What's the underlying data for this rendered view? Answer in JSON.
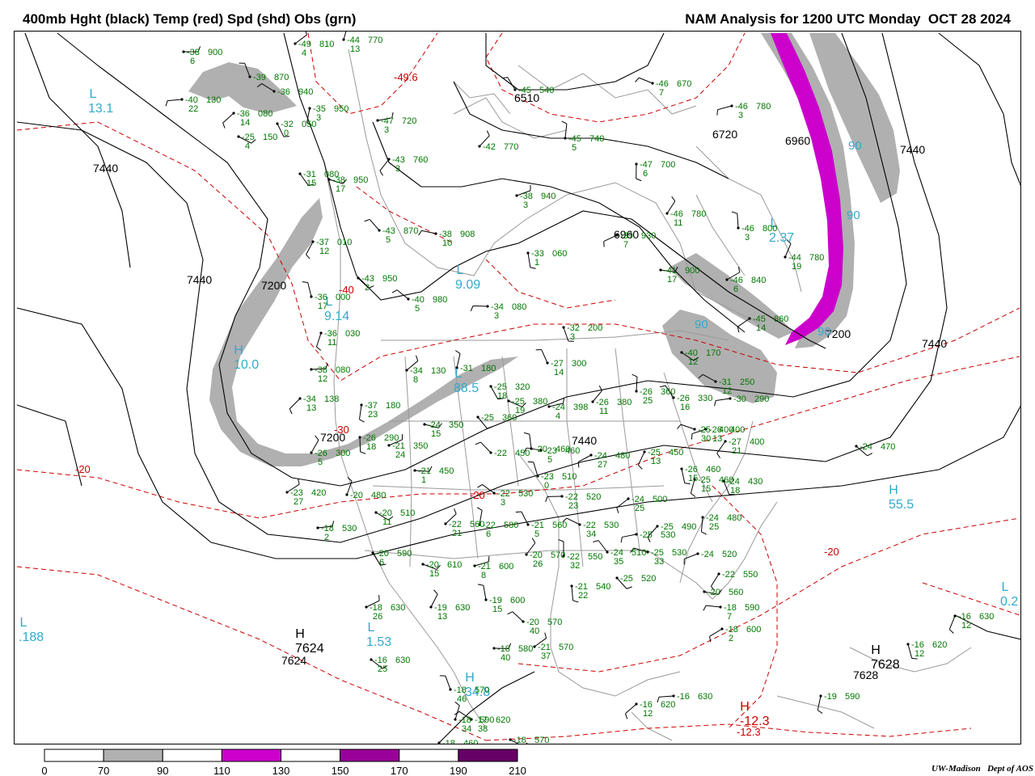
{
  "header": {
    "title_left": "400mb Hght (black) Temp (red) Spd (shd) Obs (grn)",
    "title_right": "NAM Analysis for 1200 UTC Monday  OCT 28 2024"
  },
  "colors": {
    "height_contour": "#000000",
    "temperature_contour": "#cc0000",
    "observation": "#007700",
    "extrema_label": "#33aacc",
    "geography": "#999999",
    "speed_70_90": "#b0b0b0",
    "speed_110_130": "#cc00cc",
    "speed_150_170": "#990099",
    "speed_190_210": "#660066"
  },
  "colorbar": {
    "ticks": [
      "0",
      "70",
      "90",
      "110",
      "130",
      "150",
      "170",
      "190",
      "210"
    ],
    "bins": [
      {
        "from": 0,
        "to": 70,
        "color": "#ffffff"
      },
      {
        "from": 70,
        "to": 90,
        "color": "#b0b0b0"
      },
      {
        "from": 90,
        "to": 110,
        "color": "#ffffff"
      },
      {
        "from": 110,
        "to": 130,
        "color": "#cc00cc"
      },
      {
        "from": 130,
        "to": 150,
        "color": "#ffffff"
      },
      {
        "from": 150,
        "to": 170,
        "color": "#990099"
      },
      {
        "from": 170,
        "to": 190,
        "color": "#ffffff"
      },
      {
        "from": 190,
        "to": 210,
        "color": "#660066"
      }
    ]
  },
  "height_labels": [
    "7440",
    "7200",
    "7440",
    "7200",
    "6960",
    "6720",
    "7440",
    "7440",
    "7200",
    "7440",
    "6510",
    "7624",
    "7628",
    "6960"
  ],
  "temperature_labels": [
    "-20",
    "-20",
    "-20",
    "-30",
    "-40",
    "-49.6",
    "-12.3"
  ],
  "extrema": [
    {
      "letter": "L",
      "value": "13.1"
    },
    {
      "letter": "H",
      "value": "10.0"
    },
    {
      "letter": "L",
      "value": "9.09"
    },
    {
      "letter": "L",
      "value": "9.14"
    },
    {
      "letter": "L",
      "value": "88.5"
    },
    {
      "letter": "H",
      "value": "55.5"
    },
    {
      "letter": "L",
      "value": "1.53"
    },
    {
      "letter": "L",
      "value": ".188"
    },
    {
      "letter": "H",
      "value": "34.8"
    },
    {
      "letter": "L",
      "value": "0.2"
    },
    {
      "letter": "L",
      "value": "2.37"
    },
    {
      "letter": "H",
      "value": "7624"
    },
    {
      "letter": "H",
      "value": "7628"
    },
    {
      "letter": "H",
      "value": "-12.3"
    }
  ],
  "speed_labels": [
    "90",
    "90",
    "90",
    "90"
  ],
  "observations": [
    {
      "t": "-38",
      "h": "900",
      "d": "6"
    },
    {
      "t": "-49",
      "h": "810",
      "d": "4"
    },
    {
      "t": "-44",
      "h": "770",
      "d": "13"
    },
    {
      "t": "-39",
      "h": "870",
      "d": ""
    },
    {
      "t": "-36",
      "h": "940",
      "d": ""
    },
    {
      "t": "-40",
      "h": "130",
      "d": "22"
    },
    {
      "t": "-36",
      "h": "080",
      "d": "14"
    },
    {
      "t": "-35",
      "h": "950",
      "d": "3"
    },
    {
      "t": "-32",
      "h": "050",
      "d": "0"
    },
    {
      "t": "-25",
      "h": "150",
      "d": "4"
    },
    {
      "t": "-47",
      "h": "720",
      "d": "3"
    },
    {
      "t": "-42",
      "h": "770",
      "d": ""
    },
    {
      "t": "-45",
      "h": "740",
      "d": "5"
    },
    {
      "t": "-45",
      "h": "540",
      "d": ""
    },
    {
      "t": "-46",
      "h": "670",
      "d": "7"
    },
    {
      "t": "-46",
      "h": "780",
      "d": "3"
    },
    {
      "t": "-43",
      "h": "760",
      "d": "3"
    },
    {
      "t": "-47",
      "h": "700",
      "d": "6"
    },
    {
      "t": "-31",
      "h": "080",
      "d": "15"
    },
    {
      "t": "-38",
      "h": "950",
      "d": "17"
    },
    {
      "t": "-38",
      "h": "940",
      "d": "3"
    },
    {
      "t": "-46",
      "h": "780",
      "d": "11"
    },
    {
      "t": "-46",
      "h": "800",
      "d": "3"
    },
    {
      "t": "-43",
      "h": "870",
      "d": "5"
    },
    {
      "t": "-38",
      "h": "908",
      "d": "10"
    },
    {
      "t": "-39",
      "h": "930",
      "d": "7"
    },
    {
      "t": "-37",
      "h": "010",
      "d": "12"
    },
    {
      "t": "-33",
      "h": "060",
      "d": "1"
    },
    {
      "t": "-43",
      "h": "950",
      "d": "2"
    },
    {
      "t": "-41",
      "h": "900",
      "d": "17"
    },
    {
      "t": "-46",
      "h": "840",
      "d": "6"
    },
    {
      "t": "-44",
      "h": "780",
      "d": "19"
    },
    {
      "t": "-36",
      "h": "000",
      "d": "17"
    },
    {
      "t": "-40",
      "h": "980",
      "d": "5"
    },
    {
      "t": "-34",
      "h": "080",
      "d": "3"
    },
    {
      "t": "-45",
      "h": "860",
      "d": "14"
    },
    {
      "t": "-36",
      "h": "030",
      "d": "11"
    },
    {
      "t": "-32",
      "h": "200",
      "d": "3"
    },
    {
      "t": "-40",
      "h": "170",
      "d": "12"
    },
    {
      "t": "-38",
      "h": "080",
      "d": "12"
    },
    {
      "t": "-34",
      "h": "130",
      "d": "8"
    },
    {
      "t": "-31",
      "h": "180",
      "d": ""
    },
    {
      "t": "-27",
      "h": "300",
      "d": "14"
    },
    {
      "t": "-31",
      "h": "250",
      "d": "12"
    },
    {
      "t": "-30",
      "h": "290",
      "d": ""
    },
    {
      "t": "-34",
      "h": "138",
      "d": "13"
    },
    {
      "t": "-37",
      "h": "180",
      "d": "23"
    },
    {
      "t": "-25",
      "h": "320",
      "d": "18"
    },
    {
      "t": "-25",
      "h": "380",
      "d": "19"
    },
    {
      "t": "-24",
      "h": "398",
      "d": "4"
    },
    {
      "t": "-26",
      "h": "380",
      "d": "11"
    },
    {
      "t": "-26",
      "h": "360",
      "d": "25"
    },
    {
      "t": "-26",
      "h": "330",
      "d": "16"
    },
    {
      "t": "-25",
      "h": "400",
      "d": "30"
    },
    {
      "t": "-26",
      "h": "400",
      "d": "13"
    },
    {
      "t": "-27",
      "h": "400",
      "d": "21"
    },
    {
      "t": "-26",
      "h": "290",
      "d": "18"
    },
    {
      "t": "-25",
      "h": "360",
      "d": ""
    },
    {
      "t": "-24",
      "h": "350",
      "d": "15"
    },
    {
      "t": "-21",
      "h": "350",
      "d": "24"
    },
    {
      "t": "-26",
      "h": "300",
      "d": "5"
    },
    {
      "t": "-20",
      "h": "460",
      "d": ""
    },
    {
      "t": "-22",
      "h": "450",
      "d": ""
    },
    {
      "t": "-23",
      "h": "460",
      "d": "5"
    },
    {
      "t": "-24",
      "h": "480",
      "d": "27"
    },
    {
      "t": "-25",
      "h": "450",
      "d": "13"
    },
    {
      "t": "-26",
      "h": "460",
      "d": "15"
    },
    {
      "t": "-24",
      "h": "470",
      "d": ""
    },
    {
      "t": "-21",
      "h": "450",
      "d": "1"
    },
    {
      "t": "-23",
      "h": "420",
      "d": "27"
    },
    {
      "t": "-20",
      "h": "480",
      "d": ""
    },
    {
      "t": "-23",
      "h": "510",
      "d": "0"
    },
    {
      "t": "-22",
      "h": "530",
      "d": "3"
    },
    {
      "t": "-22",
      "h": "520",
      "d": "23"
    },
    {
      "t": "-24",
      "h": "500",
      "d": "25"
    },
    {
      "t": "-25",
      "h": "460",
      "d": "15"
    },
    {
      "t": "-24",
      "h": "430",
      "d": "18"
    },
    {
      "t": "-20",
      "h": "510",
      "d": "11"
    },
    {
      "t": "-18",
      "h": "530",
      "d": "2"
    },
    {
      "t": "-22",
      "h": "560",
      "d": "21"
    },
    {
      "t": "-22",
      "h": "580",
      "d": "6"
    },
    {
      "t": "-21",
      "h": "560",
      "d": "5"
    },
    {
      "t": "-22",
      "h": "530",
      "d": "34"
    },
    {
      "t": "-25",
      "h": "530",
      "d": ""
    },
    {
      "t": "-25",
      "h": "490",
      "d": ""
    },
    {
      "t": "-24",
      "h": "480",
      "d": "25"
    },
    {
      "t": "-20",
      "h": "590",
      "d": "6"
    },
    {
      "t": "-20",
      "h": "610",
      "d": "15"
    },
    {
      "t": "-21",
      "h": "600",
      "d": "8"
    },
    {
      "t": "-20",
      "h": "570",
      "d": "26"
    },
    {
      "t": "-22",
      "h": "550",
      "d": "32"
    },
    {
      "t": "-24",
      "h": "510",
      "d": "35"
    },
    {
      "t": "-25",
      "h": "530",
      "d": "33"
    },
    {
      "t": "-24",
      "h": "520",
      "d": ""
    },
    {
      "t": "-22",
      "h": "550",
      "d": ""
    },
    {
      "t": "-21",
      "h": "540",
      "d": "22"
    },
    {
      "t": "-25",
      "h": "520",
      "d": ""
    },
    {
      "t": "-20",
      "h": "560",
      "d": ""
    },
    {
      "t": "-18",
      "h": "630",
      "d": "26"
    },
    {
      "t": "-19",
      "h": "630",
      "d": "13"
    },
    {
      "t": "-19",
      "h": "600",
      "d": "15"
    },
    {
      "t": "-20",
      "h": "570",
      "d": "40"
    },
    {
      "t": "-18",
      "h": "590",
      "d": "7"
    },
    {
      "t": "-18",
      "h": "600",
      "d": "2"
    },
    {
      "t": "-16",
      "h": "630",
      "d": "12"
    },
    {
      "t": "-16",
      "h": "620",
      "d": "12"
    },
    {
      "t": "-16",
      "h": "630",
      "d": "25"
    },
    {
      "t": "-18",
      "h": "580",
      "d": "40"
    },
    {
      "t": "-21",
      "h": "570",
      "d": "37"
    },
    {
      "t": "-18",
      "h": "590",
      "d": "34"
    },
    {
      "t": "-18",
      "h": "570",
      "d": "46"
    },
    {
      "t": "-17",
      "h": "620",
      "d": "38"
    },
    {
      "t": "-16",
      "h": "630",
      "d": ""
    },
    {
      "t": "-16",
      "h": "620",
      "d": "12"
    },
    {
      "t": "-19",
      "h": "590",
      "d": ""
    },
    {
      "t": "-18",
      "h": "460",
      "d": ""
    },
    {
      "t": "-18",
      "h": "570",
      "d": ""
    }
  ],
  "credit": "UW-Madison   Dept of AOS"
}
